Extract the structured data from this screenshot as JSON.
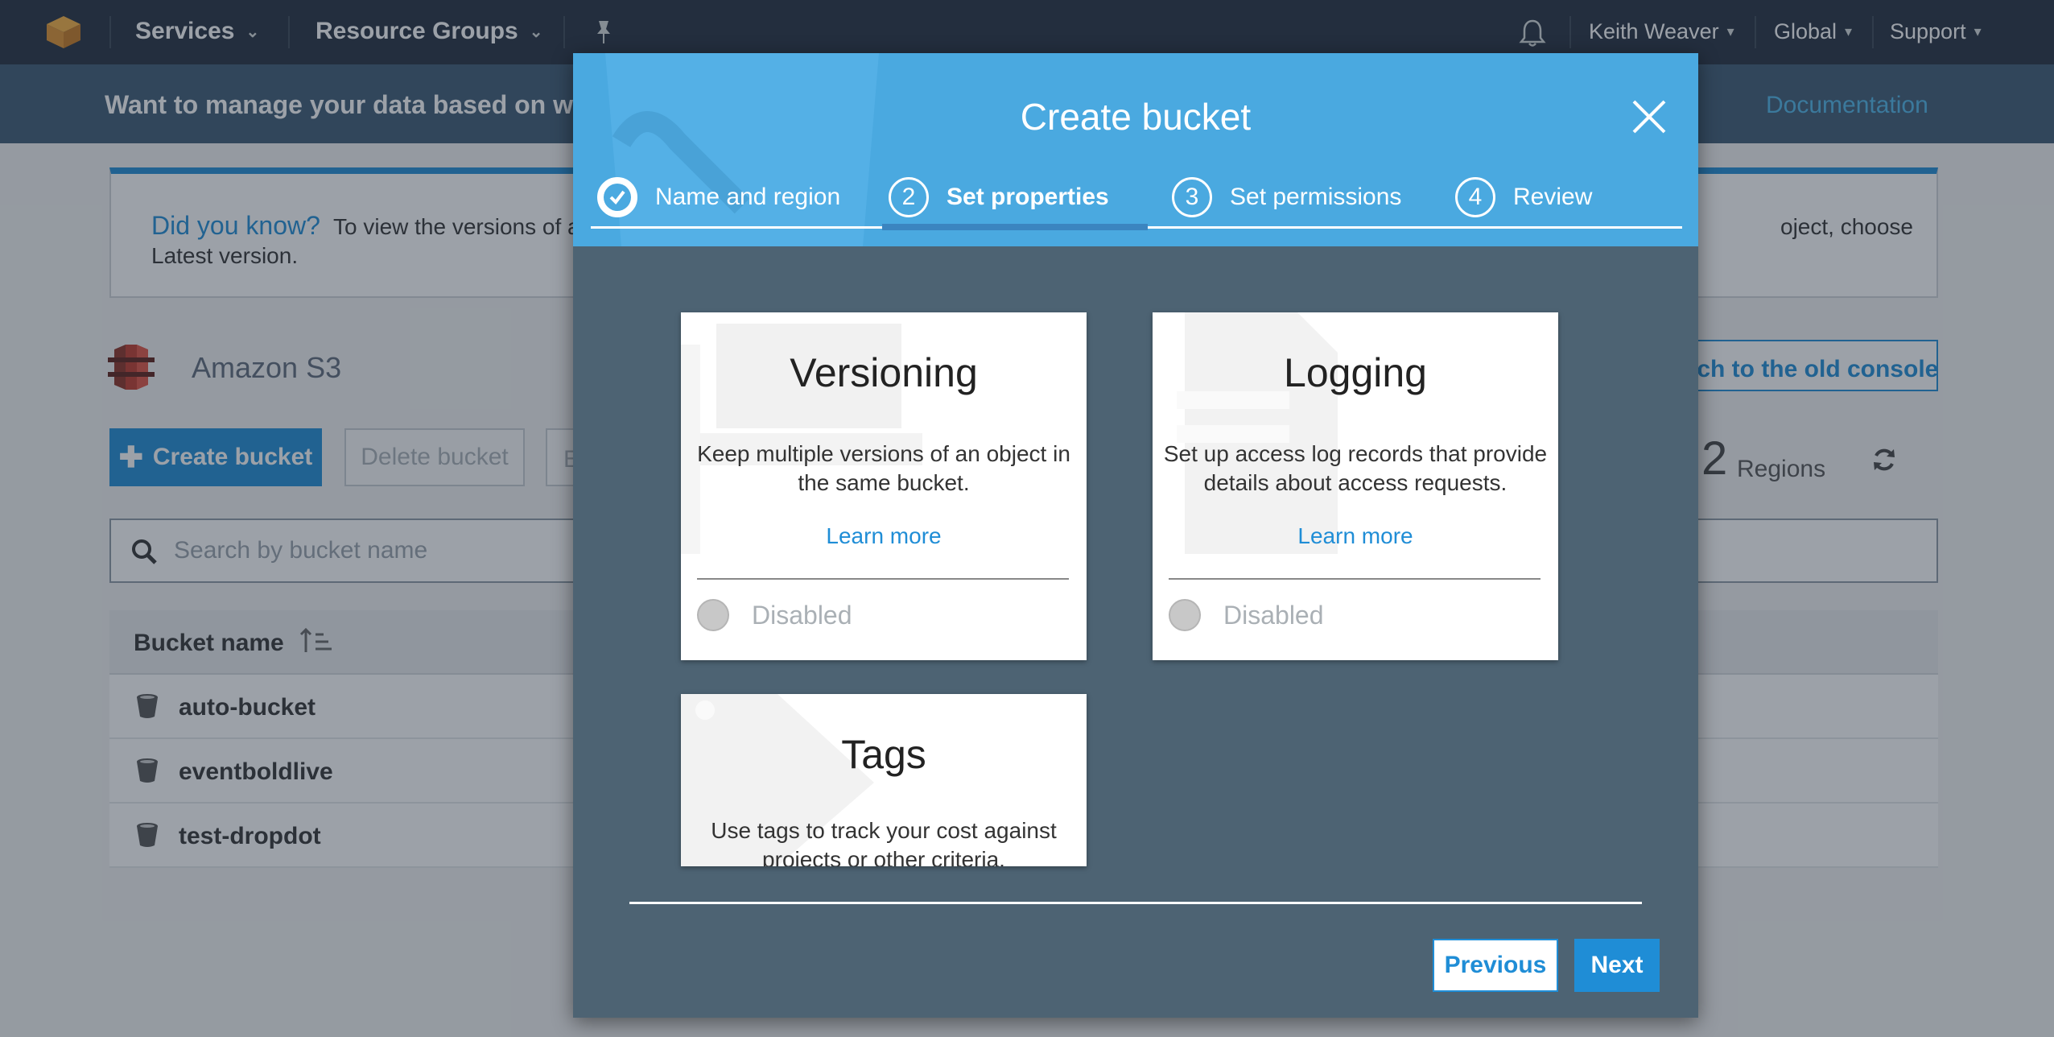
{
  "nav": {
    "services": "Services",
    "resource_groups": "Resource Groups",
    "user": "Keith Weaver",
    "region": "Global",
    "support": "Support"
  },
  "banner": {
    "text": "Want to manage your data based on w",
    "documentation": "Documentation"
  },
  "info": {
    "title": "Did you know?",
    "body_part1": "To view the versions of a",
    "body_part2": "Latest version.",
    "body_part3": "oject, choose"
  },
  "s3": {
    "title": "Amazon S3",
    "old_console": "itch to the old console",
    "create_bucket": "Create bucket",
    "delete_bucket": "Delete bucket",
    "third_button": "E",
    "regions_count": "2",
    "regions_label": "Regions",
    "search_placeholder": "Search by bucket name",
    "column_bucket_name": "Bucket name",
    "buckets": [
      "auto-bucket",
      "eventboldlive",
      "test-dropdot"
    ]
  },
  "modal": {
    "title": "Create bucket",
    "steps": [
      {
        "number": "✓",
        "label": "Name and region"
      },
      {
        "number": "2",
        "label": "Set properties"
      },
      {
        "number": "3",
        "label": "Set permissions"
      },
      {
        "number": "4",
        "label": "Review"
      }
    ],
    "cards": [
      {
        "title": "Versioning",
        "desc": "Keep multiple versions of an object in the same bucket.",
        "link": "Learn more",
        "status": "Disabled"
      },
      {
        "title": "Logging",
        "desc": "Set up access log records that provide details about access requests.",
        "link": "Learn more",
        "status": "Disabled"
      },
      {
        "title": "Tags",
        "desc": "Use tags to track your cost against projects or other criteria."
      }
    ],
    "previous": "Previous",
    "next": "Next"
  },
  "colors": {
    "nav_bg": "#232f3e",
    "modal_header": "#4aa9e0",
    "modal_body": "#4d6373",
    "accent": "#1f8dd6"
  }
}
